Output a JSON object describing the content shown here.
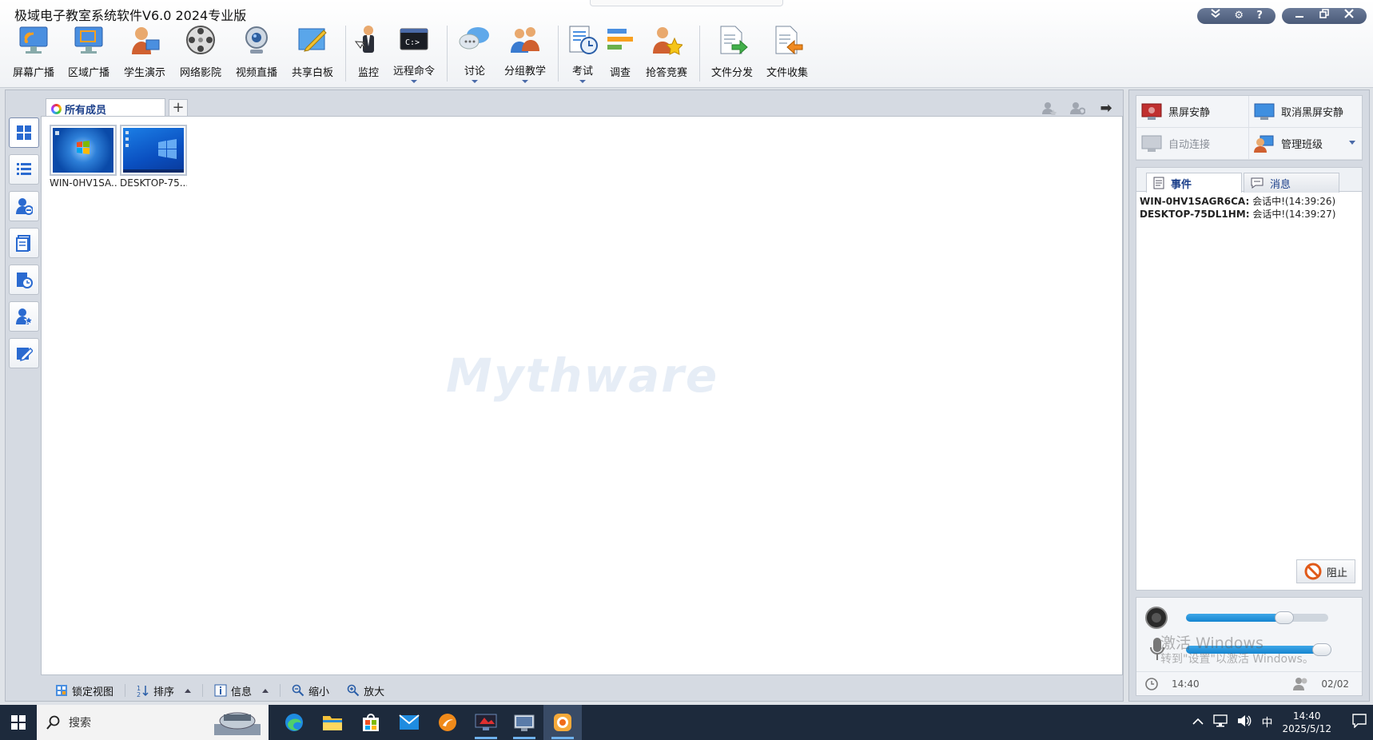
{
  "app": {
    "title": "极域电子教室系统软件V6.0 2024专业版",
    "accent": "#1b3f8a"
  },
  "toolbar": {
    "items": [
      {
        "label": "屏幕广播",
        "icon": "screen-broadcast-icon"
      },
      {
        "label": "区域广播",
        "icon": "area-broadcast-icon"
      },
      {
        "label": "学生演示",
        "icon": "student-demo-icon"
      },
      {
        "label": "网络影院",
        "icon": "film-reel-icon"
      },
      {
        "label": "视频直播",
        "icon": "webcam-icon"
      },
      {
        "label": "共享白板",
        "icon": "whiteboard-icon"
      },
      {
        "label": "监控",
        "icon": "monitor-person-icon"
      },
      {
        "label": "远程命令",
        "icon": "command-prompt-icon"
      },
      {
        "label": "讨论",
        "icon": "chat-bubbles-icon"
      },
      {
        "label": "分组教学",
        "icon": "group-teaching-icon"
      },
      {
        "label": "考试",
        "icon": "exam-clock-icon"
      },
      {
        "label": "调查",
        "icon": "survey-bars-icon"
      },
      {
        "label": "抢答竞赛",
        "icon": "quiz-star-icon"
      },
      {
        "label": "文件分发",
        "icon": "file-send-icon"
      },
      {
        "label": "文件收集",
        "icon": "file-collect-icon"
      }
    ]
  },
  "main": {
    "tab_label": "所有成员",
    "add_tab": "+",
    "watermark": "Mythware",
    "students": [
      {
        "name": "WIN-0HV1SA...",
        "screen": "win7"
      },
      {
        "name": "DESKTOP-75...",
        "screen": "win10"
      }
    ],
    "statusbar": {
      "lock_view": "锁定视图",
      "sort": "排序",
      "info": "信息",
      "zoom_out": "缩小",
      "zoom_in": "放大"
    }
  },
  "right": {
    "actions": {
      "black_screen": "黑屏安静",
      "cancel_black_screen": "取消黑屏安静",
      "auto_connect": "自动连接",
      "manage_class": "管理班级"
    },
    "tabs": {
      "events": "事件",
      "messages": "消息"
    },
    "events": [
      {
        "host": "WIN-0HV1SAGR6CA:",
        "text": "会话中!(14:39:26)"
      },
      {
        "host": "DESKTOP-75DL1HM:",
        "text": "会话中!(14:39:27)"
      }
    ],
    "block_button": "阻止",
    "audio": {
      "speaker_level": 0.69,
      "mic_level": 0.94,
      "activate_title": "激活 Windows",
      "activate_sub": "转到\"设置\"以激活 Windows。",
      "time": "14:40",
      "count": "02/02"
    }
  },
  "taskbar": {
    "search_placeholder": "搜索",
    "ime": "中",
    "time": "14:40",
    "date": "2025/5/12"
  }
}
